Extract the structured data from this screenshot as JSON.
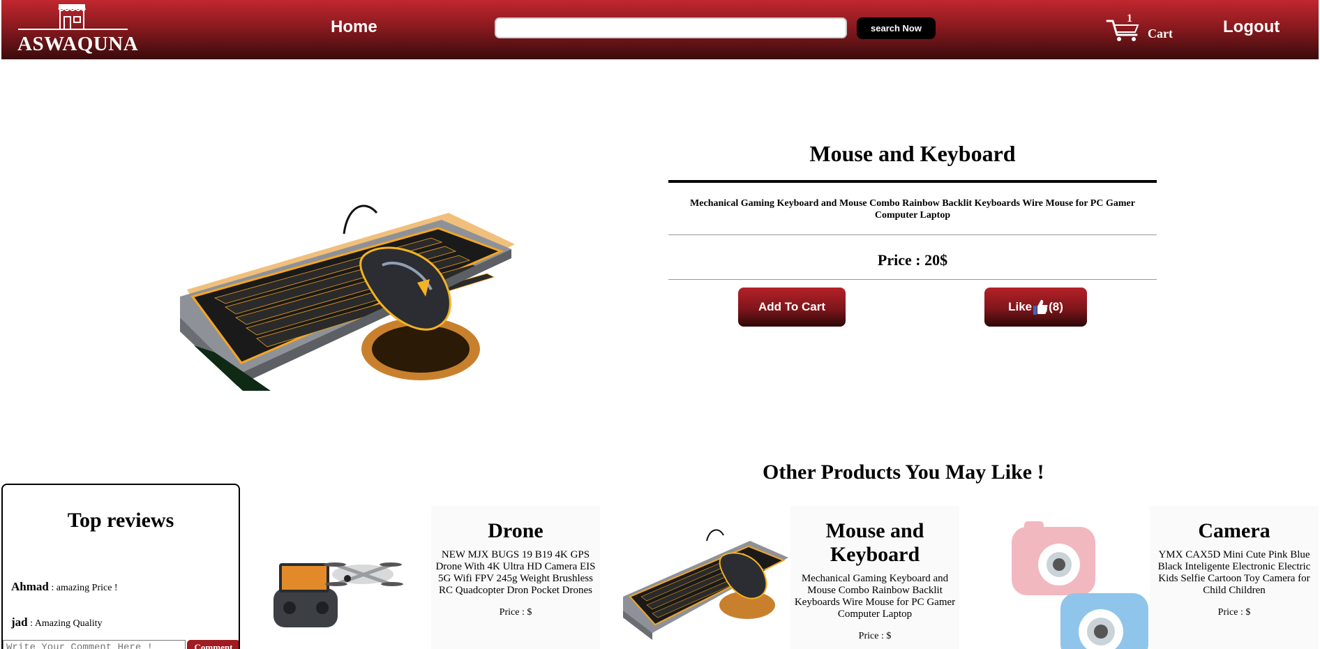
{
  "header": {
    "logo_text": "ASWAQUNA",
    "nav_home": "Home",
    "search_placeholder": "",
    "search_button": "search Now",
    "cart_count": "1",
    "cart_label": "Cart",
    "logout": "Logout"
  },
  "product": {
    "title": "Mouse and Keyboard",
    "description": "Mechanical Gaming Keyboard and Mouse Combo Rainbow Backlit Keyboards Wire Mouse for PC Gamer Computer Laptop",
    "price": "Price : 20$",
    "add_to_cart": "Add To Cart",
    "like_label": "Like",
    "like_count": "(8)"
  },
  "other_products": {
    "title": "Other Products You May Like !",
    "items": [
      {
        "name": "Drone",
        "description": "NEW MJX BUGS 19 B19 4K GPS Drone With 4K Ultra HD Camera EIS 5G Wifi FPV 245g Weight Brushless RC Quadcopter Dron Pocket Drones",
        "price": "Price : $"
      },
      {
        "name": "Mouse and Keyboard",
        "description": "Mechanical Gaming Keyboard and Mouse Combo Rainbow Backlit Keyboards Wire Mouse for PC Gamer Computer Laptop",
        "price": "Price : $"
      },
      {
        "name": "Camera",
        "description": "YMX CAX5D Mini Cute Pink Blue Black Inteligente Electronic Electric Kids Selfie Cartoon Toy Camera for Child Children",
        "price": "Price : $"
      }
    ]
  },
  "reviews": {
    "title": "Top reviews",
    "items": [
      {
        "author": "Ahmad",
        "text": " : amazing Price !"
      },
      {
        "author": "jad",
        "text": " : Amazing Quality"
      }
    ],
    "comment_placeholder": "Write Your Comment Here !",
    "comment_button": "Comment"
  },
  "colors": {
    "header_top": "#c1272f",
    "header_bottom": "#3a0b0c",
    "button_red": "#7e161b",
    "search_button": "#000000"
  },
  "icons": [
    "store-logo-icon",
    "cart-icon",
    "thumbs-up-icon"
  ]
}
